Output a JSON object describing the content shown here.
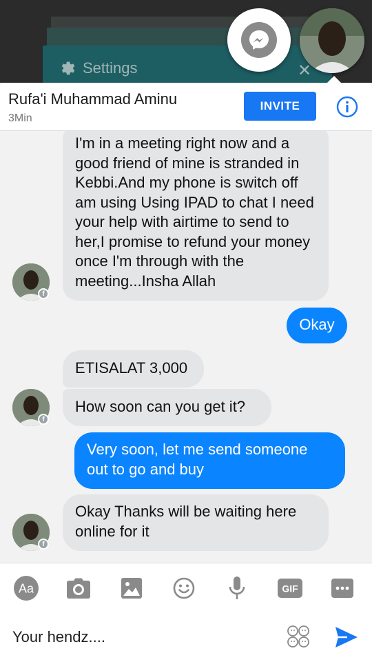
{
  "backdrop": {
    "settings_label": "Settings"
  },
  "header": {
    "contact_name": "Rufa'i Muhammad Aminu",
    "status": "3Min",
    "invite_label": "INVITE"
  },
  "messages": [
    {
      "direction": "incoming",
      "text": "I'm in a meeting right now and a good friend of mine is stranded in Kebbi.And my phone is switch off am using Using IPAD to chat I need your help with airtime to send to her,I promise to refund your money once I'm through with the meeting...Insha Allah"
    },
    {
      "direction": "outgoing",
      "text": "Okay"
    },
    {
      "direction": "incoming",
      "text": "ETISALAT 3,000"
    },
    {
      "direction": "incoming",
      "text": "How soon can you get it?"
    },
    {
      "direction": "outgoing",
      "text": "Very soon, let me send someone out to go and buy"
    },
    {
      "direction": "incoming",
      "text": "Okay Thanks will be waiting here online for it"
    }
  ],
  "toolbar": {
    "aa_label": "Aa",
    "gif_label": "GIF",
    "icons": [
      "aa-icon",
      "camera-icon",
      "image-icon",
      "emoji-icon",
      "microphone-icon",
      "gif-icon",
      "more-icon"
    ]
  },
  "composer": {
    "value": "Your hendz...."
  },
  "colors": {
    "accent": "#1877f2",
    "outgoing_bubble": "#0a84ff",
    "incoming_bubble": "#e4e5e6"
  }
}
